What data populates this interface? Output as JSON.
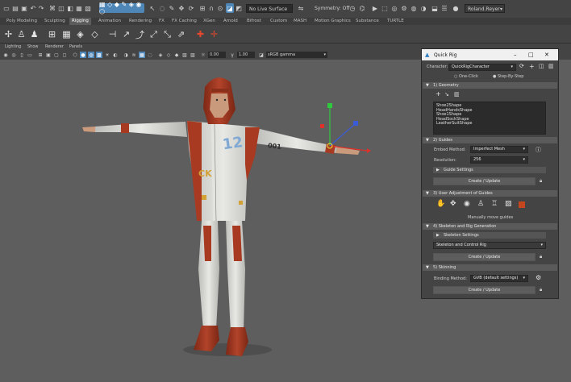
{
  "topbar": {
    "live_surface": "No Live Surface",
    "symmetry": "Symmetry: Off",
    "user": "Roland.Reyer"
  },
  "shelf_tabs": [
    "Poly Modeling",
    "Sculpting",
    "Rigging",
    "Animation",
    "Rendering",
    "FX",
    "FX Caching",
    "XGen",
    "Arnold",
    "Bifrost",
    "Custom",
    "MASH",
    "Motion Graphics",
    "Substance",
    "TURTLE"
  ],
  "shelf_active_tab": "Rigging",
  "panel_menu": [
    "Lighting",
    "Show",
    "Renderer",
    "Panels"
  ],
  "panel_bar": {
    "field_a": "0.00",
    "field_b": "1.00",
    "colorspace": "sRGB gamma"
  },
  "quick_rig": {
    "title": "Quick Rig",
    "character_label": "Character:",
    "character_value": "QuickRigCharacter",
    "mode_one_click": "One-Click",
    "mode_step": "Step-By-Step",
    "sections": {
      "geometry": "Geometry",
      "guides": "Guides",
      "user_adjust": "User Adjustment of Guides",
      "skeleton": "Skeleton and Rig Generation",
      "skinning": "Skinning"
    },
    "section_numbers": [
      "1)",
      "2)",
      "3)",
      "4)",
      "5)"
    ],
    "geometry_items": [
      "Shoe2Shape",
      "HeadHandsShape",
      "Shoe1Shape",
      "HeadSockShape",
      "LeatherSuitShape"
    ],
    "embed_method_label": "Embed Method:",
    "embed_method_value": "Imperfect Mesh",
    "resolution_label": "Resolution:",
    "resolution_value": "256",
    "guide_settings": "Guide Settings",
    "create_update": "Create / Update",
    "manually_move": "Manually move guides",
    "skeleton_settings": "Skeleton Settings",
    "skeleton_dropdown": "Skeleton and Control Rig",
    "binding_method_label": "Binding Method:",
    "binding_method_value": "GVB (default settings)"
  },
  "viewport": {
    "chest_number": "12",
    "sleeve_number": "001",
    "chest_letters": "CK"
  },
  "colors": {
    "accent": "#4e86b8",
    "suit_red": "#a83a22",
    "suit_white": "#d9d9d6",
    "panel_bg": "#444444",
    "viewport_bg": "#5e5e5e"
  },
  "icons": [
    "new-scene-icon",
    "open-icon",
    "save-icon",
    "undo-icon",
    "redo-icon",
    "select-tool-icon",
    "lasso-icon",
    "paint-icon",
    "move-icon",
    "rotate-icon",
    "scale-icon",
    "snap-icon",
    "symmetry-icon",
    "render-icon",
    "ipr-icon",
    "settings-icon",
    "joint-tool-icon",
    "ik-handle-icon",
    "quick-rig-icon",
    "gear-icon",
    "lock-icon"
  ]
}
